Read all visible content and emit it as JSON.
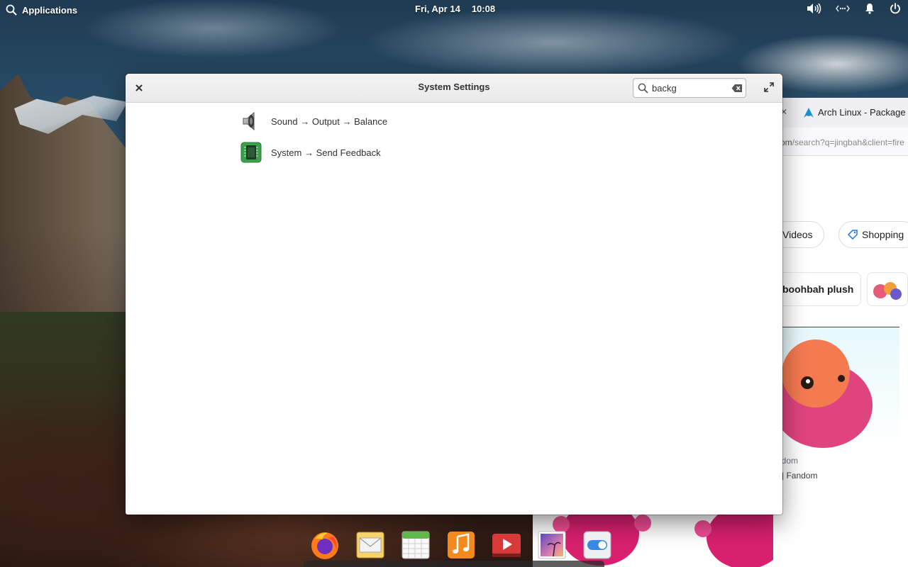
{
  "top_panel": {
    "applications_label": "Applications",
    "date": "Fri, Apr 14",
    "time": "10:08"
  },
  "window": {
    "title": "System Settings",
    "search": {
      "value": "backg",
      "placeholder": ""
    },
    "results": [
      {
        "label": "Sound → Output → Balance",
        "icon": "speaker-icon"
      },
      {
        "label": "System → Send Feedback",
        "icon": "system-chip-icon"
      }
    ]
  },
  "background_browser": {
    "tab_title": "Arch Linux - Package Se",
    "url_host_tail": "om",
    "url_path": "/search?q=jingbah&client=fire",
    "chips": [
      "Videos",
      "Shopping"
    ],
    "related_search": "boohbah plush",
    "result_source": "ndom",
    "result_caption": "ki | Fandom"
  },
  "dock": {
    "apps": [
      {
        "name": "Firefox",
        "icon": "firefox-icon"
      },
      {
        "name": "Mail",
        "icon": "mail-icon"
      },
      {
        "name": "Calendar",
        "icon": "calendar-icon"
      },
      {
        "name": "Music",
        "icon": "music-icon"
      },
      {
        "name": "Videos",
        "icon": "videos-icon"
      },
      {
        "name": "Photos",
        "icon": "photos-icon"
      },
      {
        "name": "System Settings",
        "icon": "settings-toggle-icon"
      }
    ]
  },
  "colors": {
    "accent_blue": "#3689e6",
    "titlebar": "#ececec",
    "window_bg": "#ffffff"
  }
}
